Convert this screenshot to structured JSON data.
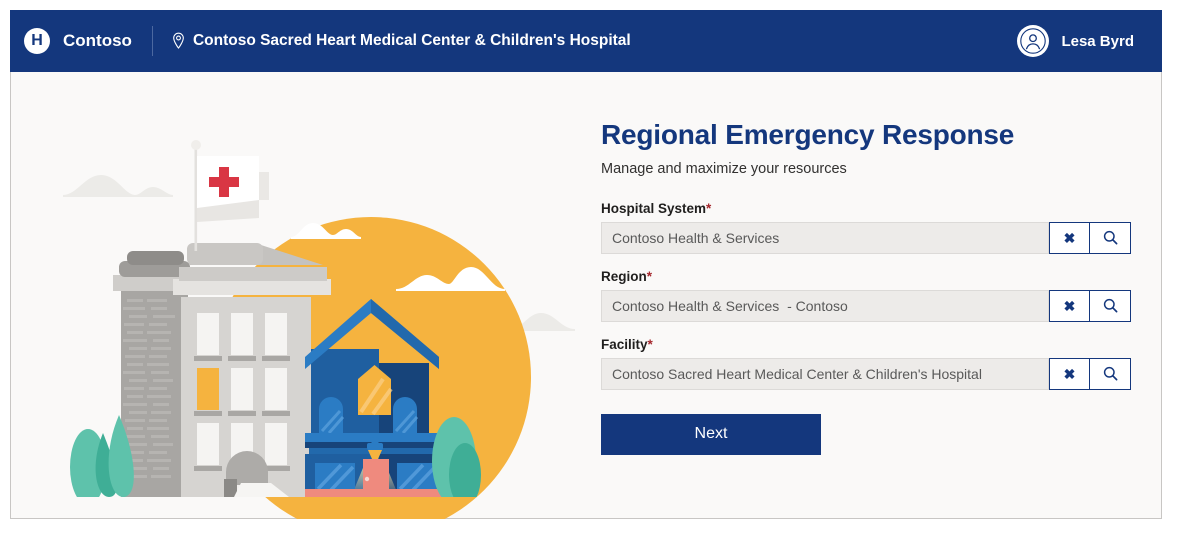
{
  "header": {
    "logo_icon": "hospital-h-logo-icon",
    "logo_letter": "H",
    "brand": "Contoso",
    "location_icon": "location-pin-icon",
    "facility": "Contoso Sacred Heart Medical Center & Children's Hospital",
    "avatar_icon": "person-avatar-icon",
    "user_name": "Lesa Byrd",
    "background_color": "#14377d"
  },
  "illustration": {
    "name": "hospital-city-illustration",
    "elements": [
      "red-cross-flag",
      "sun",
      "hospital-building",
      "blue-house",
      "trees",
      "clouds",
      "hills"
    ],
    "colors": {
      "sun": "#f5b33f",
      "house": "#1f5fa0",
      "house_dark": "#17447a",
      "roof": "#2b7cc4",
      "brick": "#a8a6a3",
      "facade": "#d6d4d1",
      "tree": "#5ec2ab",
      "tree_dark": "#3fae96",
      "door": "#ef8a7e",
      "cross": "#d93644",
      "hill": "#eceae7"
    }
  },
  "form": {
    "title": "Regional Emergency Response",
    "subtitle": "Manage and maximize your resources",
    "fields": [
      {
        "label": "Hospital System",
        "required": "*",
        "value": "Contoso Health & Services",
        "placeholder": "Contoso Health & Services",
        "clear_icon": "clear-x-icon",
        "clear_glyph": "✖",
        "search_icon": "search-icon"
      },
      {
        "label": "Region",
        "required": "*",
        "value": "Contoso Health & Services  - Contoso",
        "placeholder": "Contoso Health & Services  - Contoso",
        "clear_icon": "clear-x-icon",
        "clear_glyph": "✖",
        "search_icon": "search-icon"
      },
      {
        "label": "Facility",
        "required": "*",
        "value": "Contoso Sacred Heart Medical Center & Children's Hospital",
        "placeholder": "Contoso Sacred Heart Medical Center & Children's Hospital",
        "clear_icon": "clear-x-icon",
        "clear_glyph": "✖",
        "search_icon": "search-icon"
      }
    ],
    "submit_label": "Next",
    "accent_color": "#14377d",
    "required_color": "#a4262c"
  }
}
